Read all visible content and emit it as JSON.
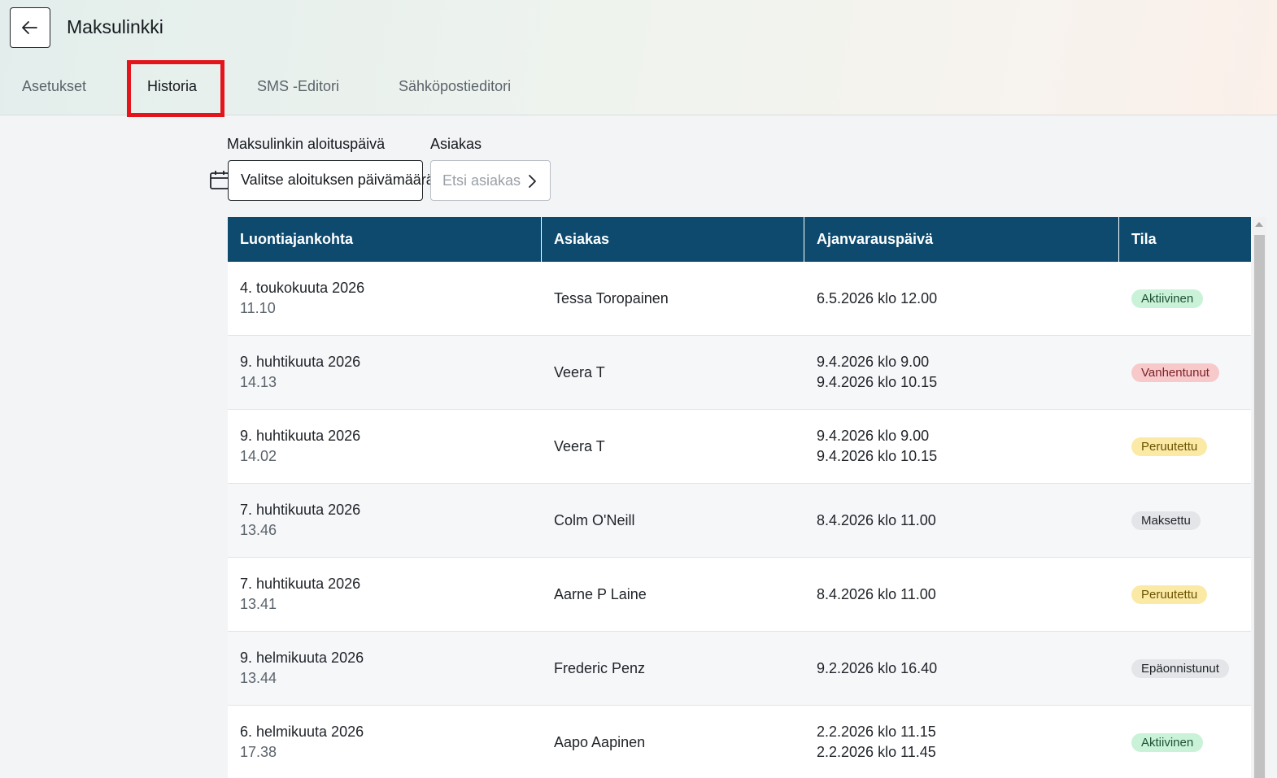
{
  "header": {
    "title": "Maksulinkki",
    "tabs": [
      "Asetukset",
      "Historia",
      "SMS -Editori",
      "Sähköpostieditori"
    ],
    "active_tab": "Historia"
  },
  "filters": {
    "start_date_label": "Maksulinkin aloituspäivä",
    "start_date_button": "Valitse aloituksen päivämäärä",
    "customer_label": "Asiakas",
    "customer_placeholder": "Etsi asiakas"
  },
  "table": {
    "columns": [
      "Luontiajankohta",
      "Asiakas",
      "Ajanvarauspäivä",
      "Tila"
    ],
    "rows": [
      {
        "date": "4. toukokuuta 2026",
        "time": "11.10",
        "customer": "Tessa Toropainen",
        "booking1": "6.5.2026 klo 12.00",
        "booking2": "",
        "status": "Aktiivinen",
        "status_bg": "#c9f2d9",
        "status_fg": "#1f5132"
      },
      {
        "date": "9. huhtikuuta 2026",
        "time": "14.13",
        "customer": "Veera T",
        "booking1": "9.4.2026 klo 9.00",
        "booking2": "9.4.2026 klo 10.15",
        "status": "Vanhentunut",
        "status_bg": "#f8c9cb",
        "status_fg": "#7a2327"
      },
      {
        "date": "9. huhtikuuta 2026",
        "time": "14.02",
        "customer": "Veera T",
        "booking1": "9.4.2026 klo 9.00",
        "booking2": "9.4.2026 klo 10.15",
        "status": "Peruutettu",
        "status_bg": "#fbe9a6",
        "status_fg": "#6a5200"
      },
      {
        "date": "7. huhtikuuta 2026",
        "time": "13.46",
        "customer": "Colm O'Neill",
        "booking1": "8.4.2026 klo 11.00",
        "booking2": "",
        "status": "Maksettu",
        "status_bg": "#e3e5e8",
        "status_fg": "#1f2328"
      },
      {
        "date": "7. huhtikuuta 2026",
        "time": "13.41",
        "customer": "Aarne P Laine",
        "booking1": "8.4.2026 klo 11.00",
        "booking2": "",
        "status": "Peruutettu",
        "status_bg": "#fbe9a6",
        "status_fg": "#6a5200"
      },
      {
        "date": "9. helmikuuta 2026",
        "time": "13.44",
        "customer": "Frederic Penz",
        "booking1": "9.2.2026 klo 16.40",
        "booking2": "",
        "status": "Epäonnistunut",
        "status_bg": "#e3e5e8",
        "status_fg": "#1f2328"
      },
      {
        "date": "6. helmikuuta 2026",
        "time": "17.38",
        "customer": "Aapo Aapinen",
        "booking1": "2.2.2026 klo 11.15",
        "booking2": "2.2.2026 klo 11.45",
        "status": "Aktiivinen",
        "status_bg": "#c9f2d9",
        "status_fg": "#1f5132"
      }
    ]
  },
  "icons": {
    "back": "arrow-left-icon",
    "calendar": "calendar-icon",
    "chevron": "chevron-right-icon"
  },
  "colors": {
    "table_header": "#0d4a6e",
    "highlight": "#e3141b"
  }
}
